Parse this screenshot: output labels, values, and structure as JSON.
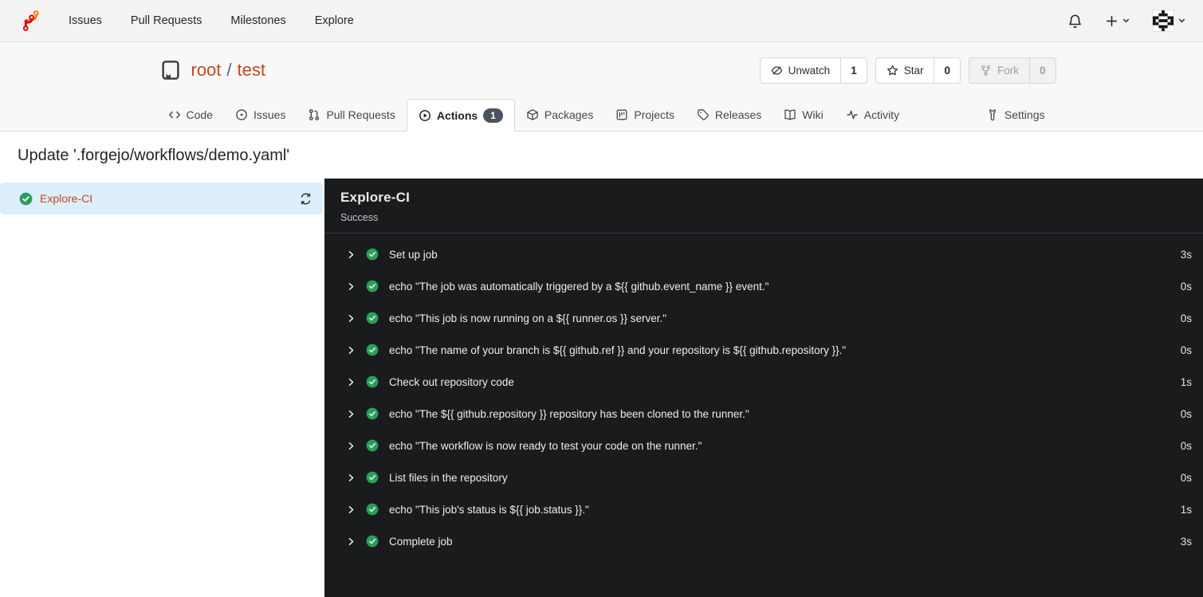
{
  "colors": {
    "accent": "#c1491d",
    "chrome_bg": "#f3f3f4",
    "chrome_bg2": "#f8f8f9",
    "chrome_border": "#dcdee1",
    "tab_border": "#d6d9dd",
    "badge_bg": "#4c5260",
    "selected_bg": "#ddeefd",
    "panel_bg": "#1a1b1c",
    "panel_border": "#363b41",
    "panel_text": "#e9ebed",
    "success_green": "#2c9d5a"
  },
  "icons": [
    "forgejo-logo",
    "bell-icon",
    "plus-icon",
    "caret-down-icon",
    "avatar-identicon",
    "repo-book-icon",
    "eye-off-icon",
    "star-icon",
    "fork-icon",
    "code-icon",
    "issue-icon",
    "pull-request-icon",
    "play-circle-icon",
    "package-icon",
    "project-icon",
    "tag-icon",
    "book-icon",
    "pulse-icon",
    "wrench-icon",
    "check-circle-icon",
    "chevron-right-icon",
    "refresh-icon"
  ],
  "navbar": {
    "items": [
      {
        "label": "Issues"
      },
      {
        "label": "Pull Requests"
      },
      {
        "label": "Milestones"
      },
      {
        "label": "Explore"
      }
    ]
  },
  "repo": {
    "owner": "root",
    "separator": "/",
    "name": "test",
    "buttons": {
      "unwatch": {
        "label": "Unwatch",
        "count": "1"
      },
      "star": {
        "label": "Star",
        "count": "0"
      },
      "fork": {
        "label": "Fork",
        "count": "0"
      }
    }
  },
  "tabs": [
    {
      "label": "Code"
    },
    {
      "label": "Issues"
    },
    {
      "label": "Pull Requests"
    },
    {
      "label": "Actions",
      "badge": "1",
      "active": true
    },
    {
      "label": "Packages"
    },
    {
      "label": "Projects"
    },
    {
      "label": "Releases"
    },
    {
      "label": "Wiki"
    },
    {
      "label": "Activity"
    },
    {
      "label": "Settings"
    }
  ],
  "run": {
    "title": "Update '.forgejo/workflows/demo.yaml'"
  },
  "sidebar": {
    "jobs": [
      {
        "name": "Explore-CI",
        "status": "success"
      }
    ]
  },
  "panel": {
    "title": "Explore-CI",
    "status": "Success",
    "steps": [
      {
        "name": "Set up job",
        "duration": "3s"
      },
      {
        "name": "echo \"The job was automatically triggered by a ${{ github.event_name }} event.\"",
        "duration": "0s"
      },
      {
        "name": "echo \"This job is now running on a ${{ runner.os }} server.\"",
        "duration": "0s"
      },
      {
        "name": "echo \"The name of your branch is ${{ github.ref }} and your repository is ${{ github.repository }}.\"",
        "duration": "0s"
      },
      {
        "name": "Check out repository code",
        "duration": "1s"
      },
      {
        "name": "echo \"The ${{ github.repository }} repository has been cloned to the runner.\"",
        "duration": "0s"
      },
      {
        "name": "echo \"The workflow is now ready to test your code on the runner.\"",
        "duration": "0s"
      },
      {
        "name": "List files in the repository",
        "duration": "0s"
      },
      {
        "name": "echo \"This job's status is ${{ job.status }}.\"",
        "duration": "1s"
      },
      {
        "name": "Complete job",
        "duration": "3s"
      }
    ]
  }
}
